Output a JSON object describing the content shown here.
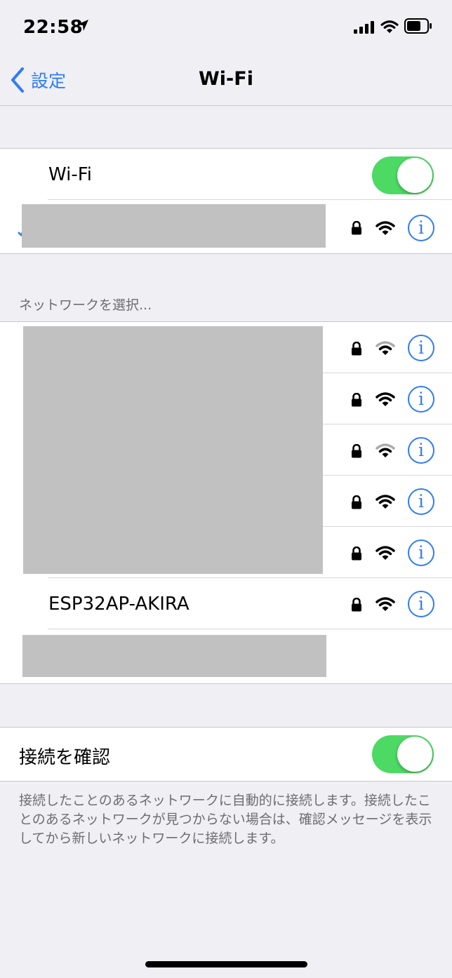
{
  "status_bar": {
    "time": "22:58"
  },
  "nav": {
    "back_label": "設定",
    "title": "Wi-Fi"
  },
  "wifi_toggle": {
    "label": "Wi-Fi",
    "on": true
  },
  "section_header": "ネットワークを選択...",
  "networks": [
    {
      "name": "",
      "locked": true,
      "signal": "weak"
    },
    {
      "name": "",
      "locked": true,
      "signal": "strong"
    },
    {
      "name": "",
      "locked": true,
      "signal": "weak"
    },
    {
      "name": "",
      "locked": true,
      "signal": "strong"
    },
    {
      "name": "",
      "locked": true,
      "signal": "strong"
    },
    {
      "name": "ESP32AP-AKIRA",
      "locked": true,
      "signal": "strong"
    }
  ],
  "ask_to_join": {
    "label": "接続を確認",
    "on": true
  },
  "footer": "接続したことのあるネットワークに自動的に接続します。接続したことのあるネットワークが見つからない場合は、確認メッセージを表示してから新しいネットワークに接続します。",
  "colors": {
    "accent": "#2f7cf6",
    "toggle_on": "#4cd964",
    "background": "#efeff4"
  },
  "icons": {
    "info": "i"
  }
}
